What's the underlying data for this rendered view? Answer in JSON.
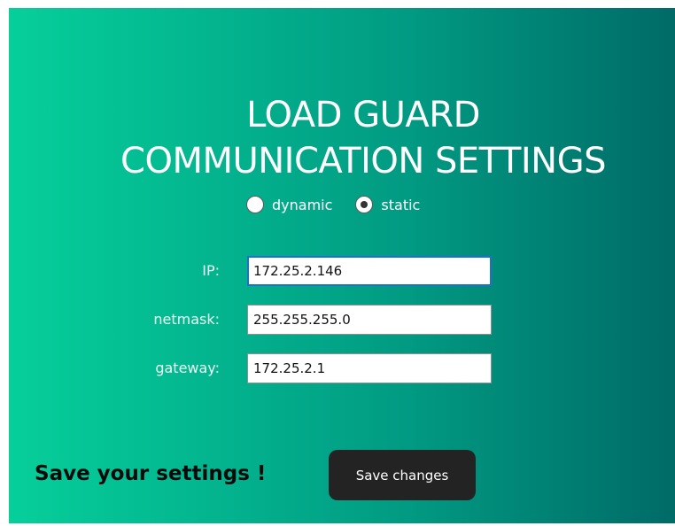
{
  "page": {
    "title_line1": "LOAD GUARD",
    "title_line2": "COMMUNICATION SETTINGS"
  },
  "mode": {
    "options": [
      {
        "label": "dynamic",
        "checked": false
      },
      {
        "label": "static",
        "checked": true
      }
    ],
    "selected": "static"
  },
  "fields": {
    "ip": {
      "label": "IP:",
      "value": "172.25.2.146",
      "focused": true
    },
    "netmask": {
      "label": "netmask:",
      "value": "255.255.255.0"
    },
    "gateway": {
      "label": "gateway:",
      "value": "172.25.2.1"
    }
  },
  "footer": {
    "message": "Save your settings !",
    "save_button_label": "Save changes"
  },
  "colors": {
    "gradient_start": "#06cf9a",
    "gradient_end": "#006b67",
    "button_bg": "#232323",
    "focus_border": "#1f6fd1"
  }
}
